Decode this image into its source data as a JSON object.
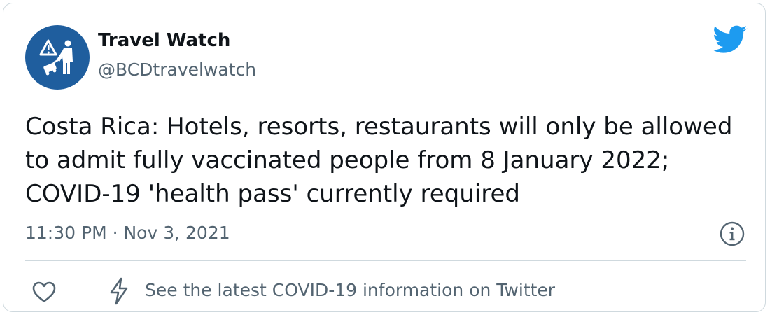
{
  "author": {
    "display_name": "Travel Watch",
    "handle": "@BCDtravelwatch",
    "avatar_color": "#1f5e9e"
  },
  "tweet": {
    "lines": [
      "Costa Rica: Hotels, resorts, restaurants will only be allowed",
      "to admit fully vaccinated people from 8 January 2022;",
      "COVID-19 'health pass' currently required"
    ],
    "timestamp": "11:30 PM · Nov 3, 2021"
  },
  "footer": {
    "covid_link": "See the latest COVID-19 information on Twitter"
  },
  "icons": {
    "brand": "twitter-bird-icon",
    "info": "info-icon",
    "like": "heart-icon",
    "covid": "lightning-bolt-icon"
  },
  "colors": {
    "twitter_blue": "#1d9bf0",
    "text_primary": "#0f1419",
    "text_secondary": "#536471",
    "border": "#cfd9de"
  }
}
